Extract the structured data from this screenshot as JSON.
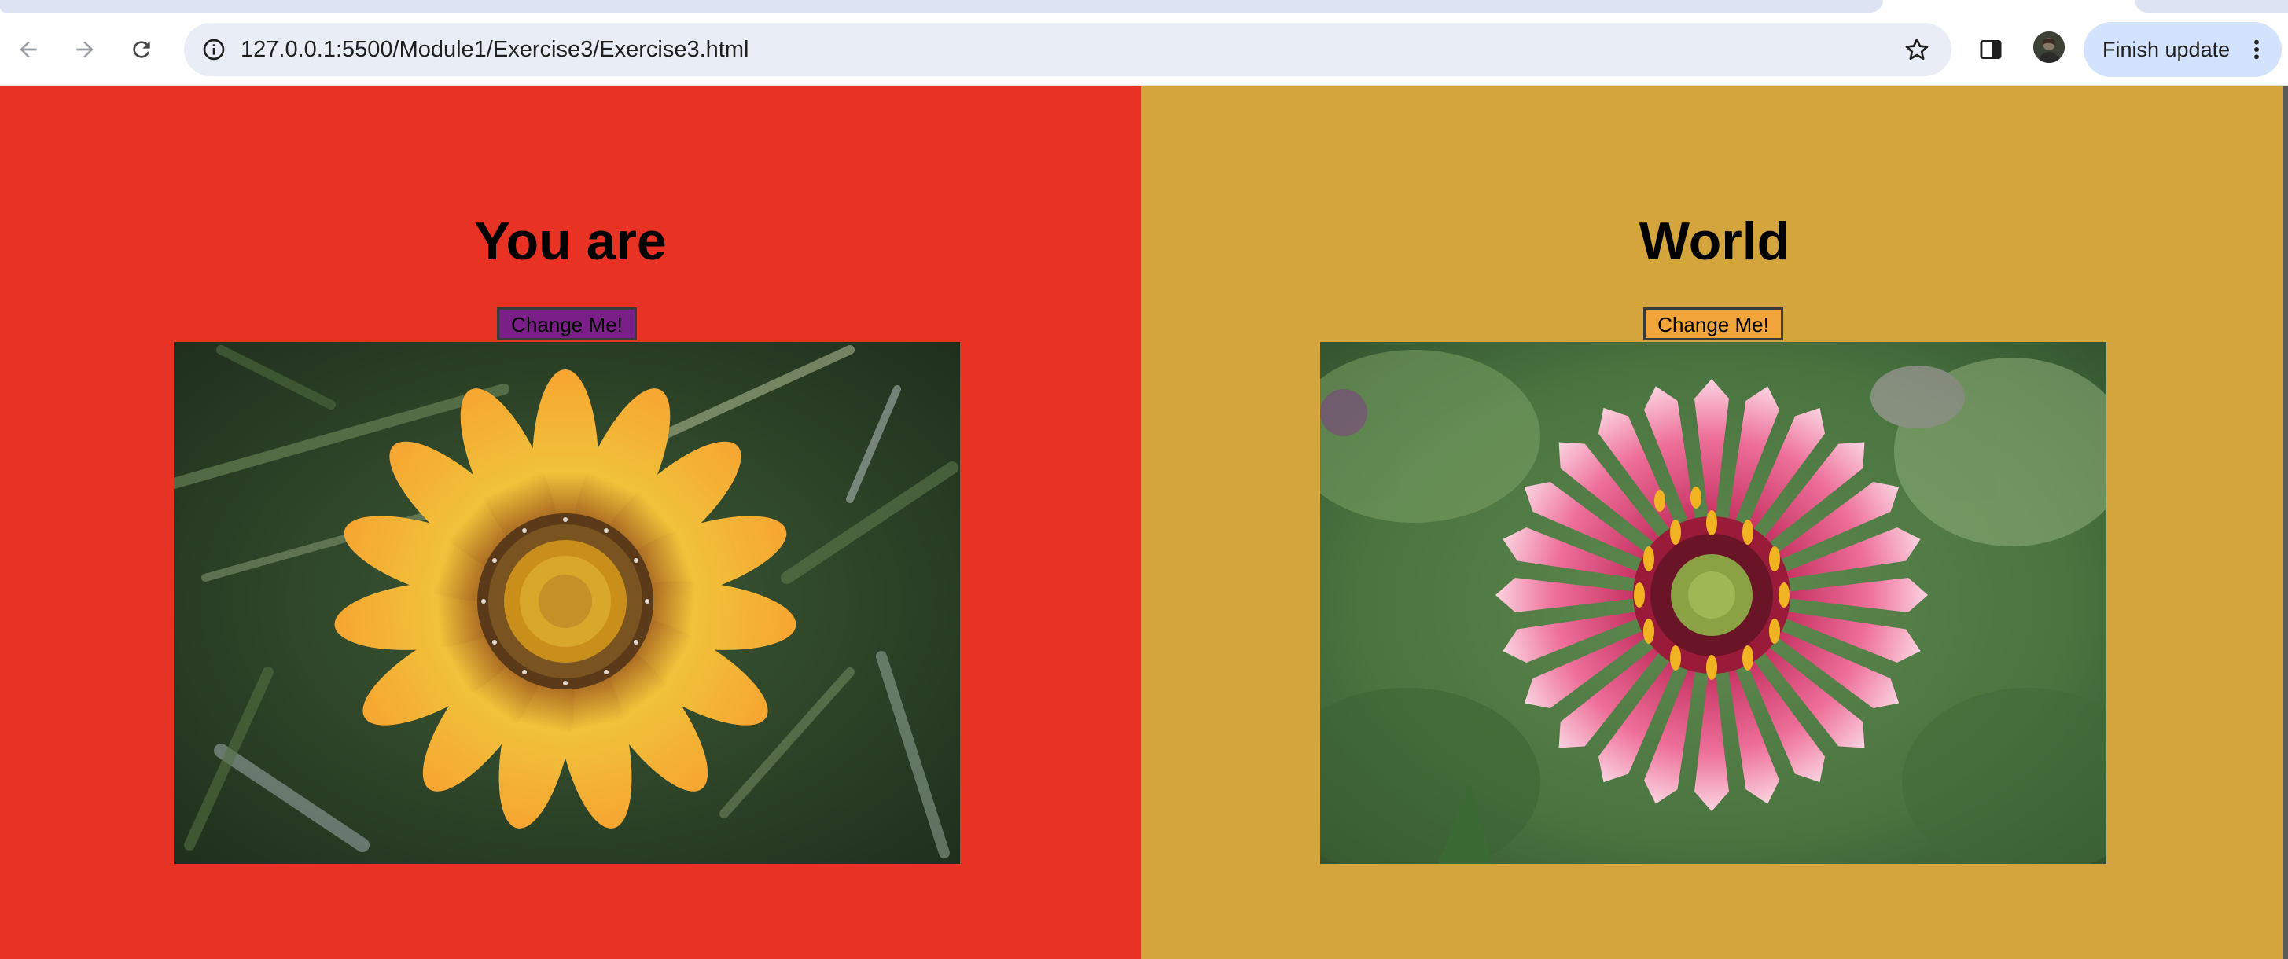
{
  "browser": {
    "url": "127.0.0.1:5500/Module1/Exercise3/Exercise3.html",
    "finish_update_label": "Finish update",
    "icons": {
      "back": "arrow-left-icon",
      "forward": "arrow-right-icon",
      "reload": "reload-icon",
      "site_info": "info-icon",
      "bookmark": "star-icon",
      "side_panel": "side-panel-icon",
      "menu": "vertical-dots-icon"
    }
  },
  "page": {
    "left_panel": {
      "heading": "You are",
      "button_label": "Change Me!",
      "background": "#e83223",
      "button_color": "#7a1f88",
      "image": "orange-yellow gazania flower photo"
    },
    "right_panel": {
      "heading": "World",
      "button_label": "Change Me!",
      "background": "#d4a53c",
      "button_color": "#f1a53a",
      "image": "pink gaillardia flower photo"
    }
  }
}
